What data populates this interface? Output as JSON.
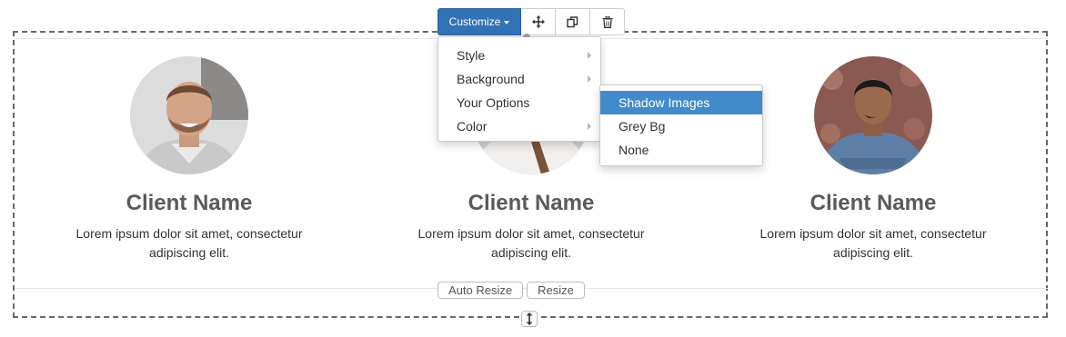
{
  "toolbar": {
    "customize_label": "Customize",
    "icons": [
      "move-icon",
      "duplicate-icon",
      "trash-icon"
    ]
  },
  "menu": {
    "items": [
      {
        "label": "Style",
        "has_submenu": true
      },
      {
        "label": "Background",
        "has_submenu": true
      },
      {
        "label": "Your Options",
        "has_submenu": false
      },
      {
        "label": "Color",
        "has_submenu": true
      }
    ]
  },
  "submenu": {
    "items": [
      {
        "label": "Shadow Images",
        "active": true
      },
      {
        "label": "Grey Bg",
        "active": false
      },
      {
        "label": "None",
        "active": false
      }
    ]
  },
  "clients": [
    {
      "name": "Client Name",
      "description": "Lorem ipsum dolor sit amet, consectetur adipiscing elit."
    },
    {
      "name": "Client Name",
      "description": "Lorem ipsum dolor sit amet, consectetur adipiscing elit."
    },
    {
      "name": "Client Name",
      "description": "Lorem ipsum dolor sit amet, consectetur adipiscing elit."
    }
  ],
  "bottom": {
    "auto_resize_label": "Auto Resize",
    "resize_label": "Resize"
  },
  "colors": {
    "accent": "#3273b5",
    "active_item": "#428bca"
  }
}
